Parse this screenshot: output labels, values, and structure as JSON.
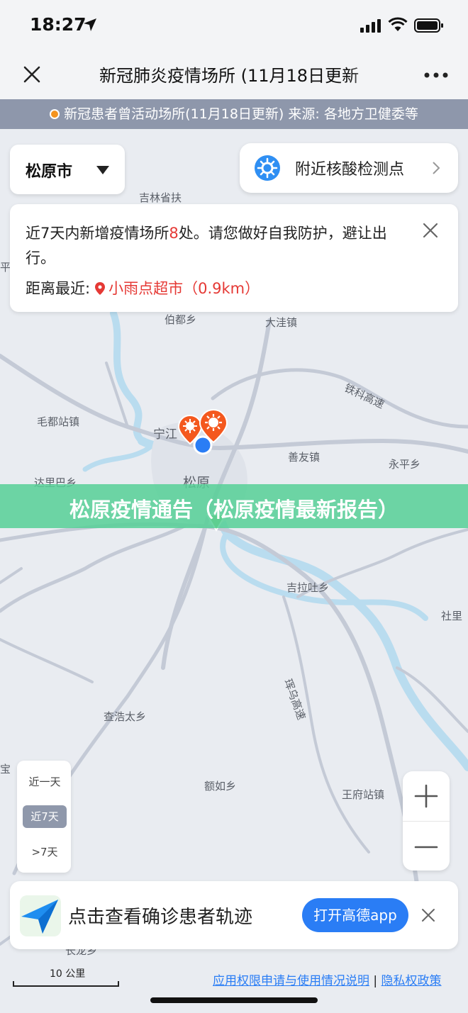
{
  "status_bar": {
    "time": "18:27"
  },
  "nav": {
    "title": "新冠肺炎疫情场所 (11月18日更新"
  },
  "info_bar": {
    "text": "新冠患者曾活动场所(11月18日更新)  来源: 各地方卫健委等"
  },
  "city_selector": {
    "label": "松原市"
  },
  "nucleic_button": {
    "label": "附近核酸检测点"
  },
  "notice": {
    "text_before": "近7天内新增疫情场所",
    "count": "8",
    "text_after": "处。请您做好自我防护，避让出行。",
    "nearest_label": "距离最近:",
    "nearest_place": "小雨点超市（0.9km）"
  },
  "map_labels": {
    "jilin": "吉林省扶",
    "bodu": "伯都乡",
    "dawa": "大洼镇",
    "maodu": "毛都站镇",
    "ningjiang": "宁江",
    "shanyou": "善友镇",
    "yongping": "永平乡",
    "dali": "达里巴乡",
    "songyuan": "松原",
    "jilatu": "吉拉吐乡",
    "shebu": "社里",
    "chahao": "查浩太乡",
    "eru": "额如乡",
    "wangfu": "王府站镇",
    "ping": "平",
    "bao": "宝",
    "changlong": "长龙乡",
    "highway1": "铁科高速",
    "highway2": "珲乌高速"
  },
  "banner": {
    "text": "松原疫情通告（松原疫情最新报告）"
  },
  "time_filter": {
    "items": [
      "近一天",
      "近7天",
      ">7天"
    ],
    "active": "近7天"
  },
  "promo": {
    "text": "点击查看确诊患者轨迹",
    "button": "打开高德app"
  },
  "scale": {
    "label": "10 公里"
  },
  "footer": {
    "link1": "应用权限申请与使用情况说明",
    "separator": "|",
    "link2": "隐私权政策"
  },
  "colors": {
    "accent": "#2a7df5",
    "alert": "#e53935",
    "banner": "#56d096",
    "marker": "#f4581e"
  }
}
